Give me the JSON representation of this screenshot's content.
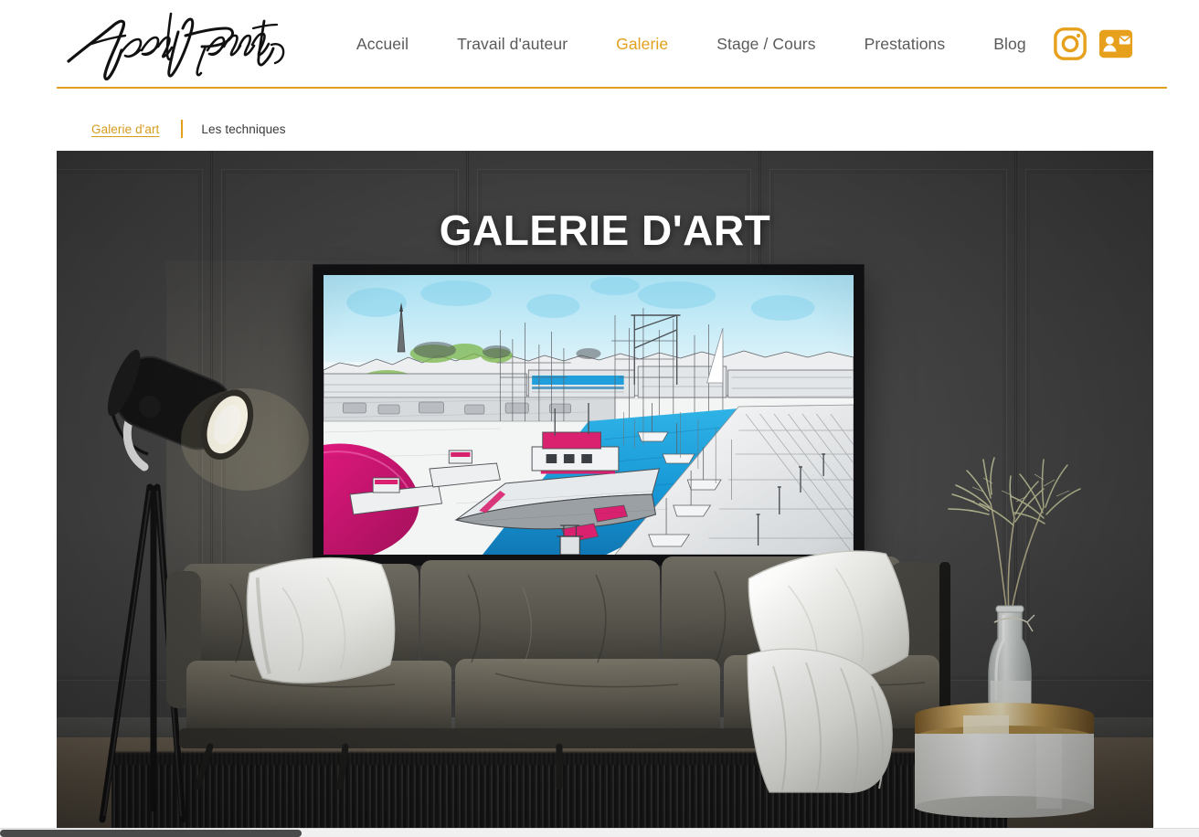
{
  "brand": {
    "logo_text": "Fred Pierrat",
    "logo_icon": "handwritten-signature-logo"
  },
  "colors": {
    "accent": "#e2a01c",
    "accent_link": "#d79b1e",
    "nav_text": "#5a5a5a",
    "breadcrumb_current": "#3a3a3a",
    "hero_wall": "#424242",
    "title_text": "#ffffff",
    "frame": "#111113"
  },
  "header": {
    "nav": [
      {
        "label": "Accueil",
        "active": false
      },
      {
        "label": "Travail d'auteur",
        "active": false
      },
      {
        "label": "Galerie",
        "active": true
      },
      {
        "label": "Stage / Cours",
        "active": false
      },
      {
        "label": "Prestations",
        "active": false
      },
      {
        "label": "Blog",
        "active": false
      }
    ],
    "social": [
      {
        "name": "instagram-icon",
        "label": "Instagram"
      },
      {
        "name": "contact-card-icon",
        "label": "Contact"
      }
    ]
  },
  "breadcrumb": {
    "link": "Galerie d'art",
    "separator": "|",
    "current": "Les techniques"
  },
  "hero": {
    "title": "GALERIE D'ART",
    "scene": {
      "description": "Interior mockup: dark grey panelled wall, framed artwork, grey leather sofa, tripod floor lamp, white side table with pampas grass",
      "artwork": {
        "subject": "Harbour / port scene with fishing boats, marina and pier",
        "style": "pencil drawing with selective colour",
        "accent_colors": [
          "#2ea8e0",
          "#c9166b",
          "#7ab648"
        ]
      }
    }
  },
  "scrollbar": {
    "orientation": "horizontal",
    "position": "bottom"
  }
}
